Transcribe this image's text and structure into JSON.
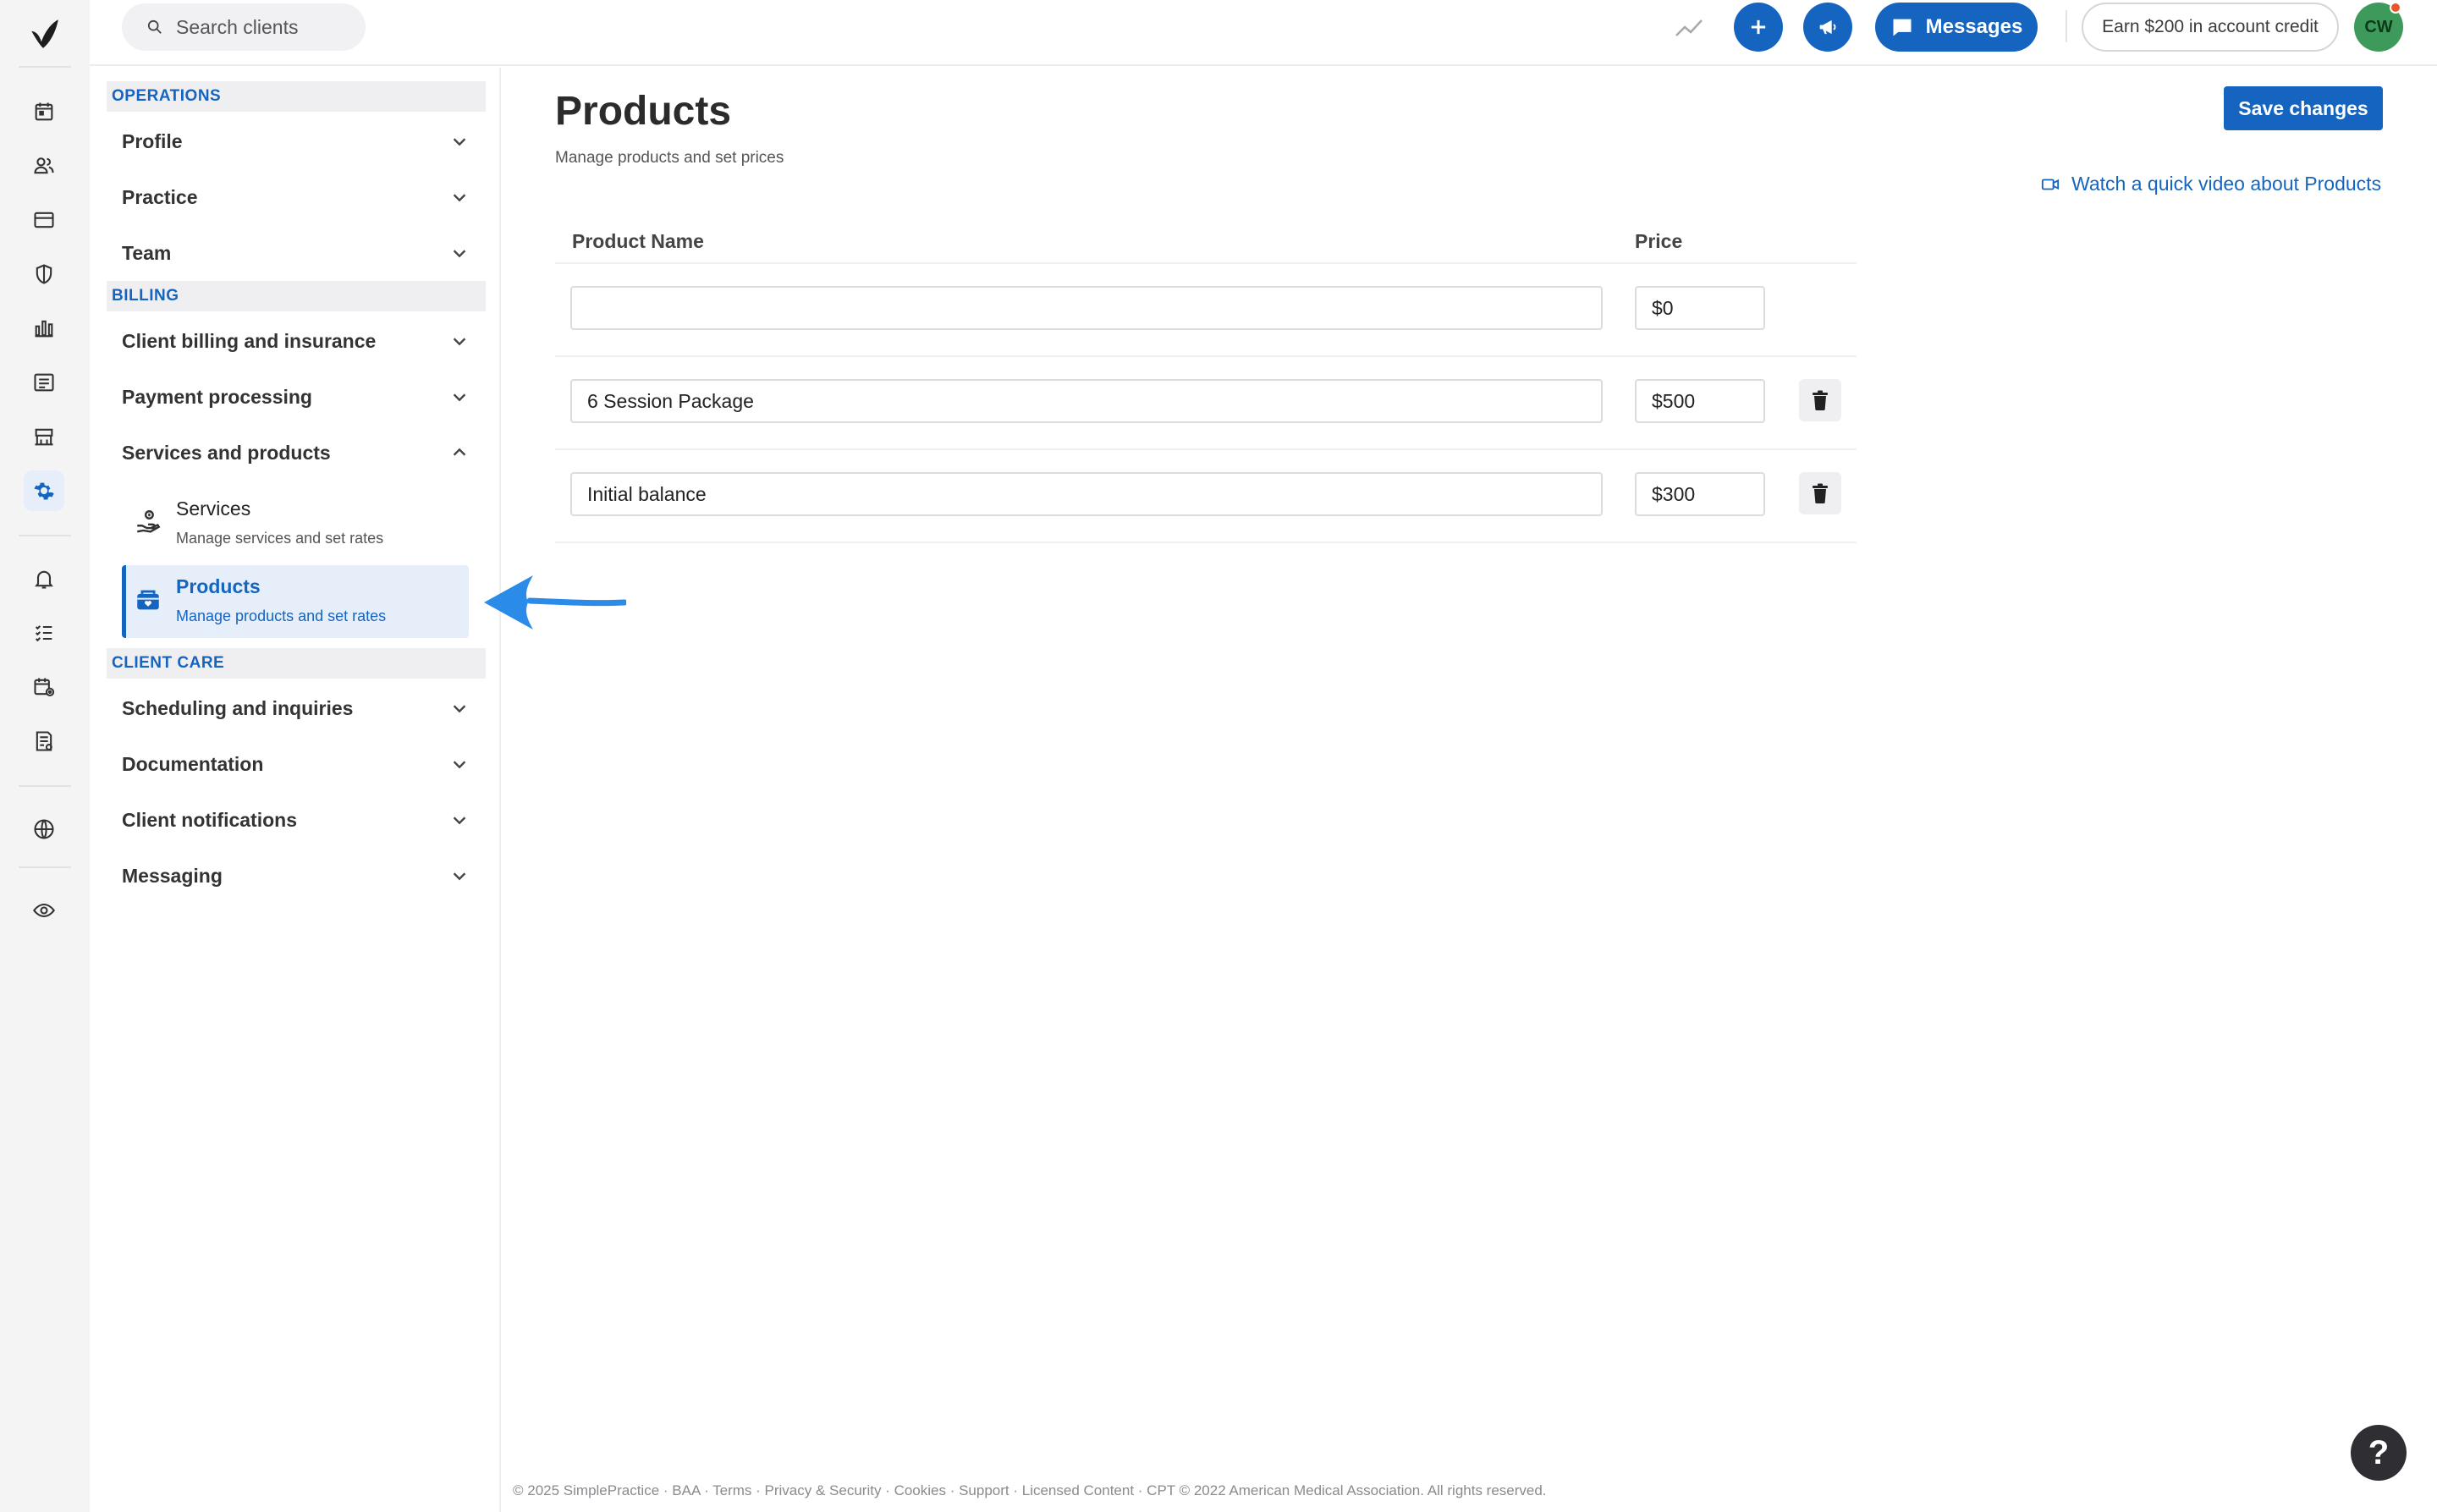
{
  "search": {
    "placeholder": "Search clients"
  },
  "topbar": {
    "messages_label": "Messages",
    "earn_label": "Earn $200 in account credit",
    "avatar_initials": "CW"
  },
  "rail": {
    "icons": [
      "logo-icon",
      "calendar-icon",
      "clients-icon",
      "billing-icon",
      "insurance-shield-icon",
      "analytics-icon",
      "documents-icon",
      "marketplace-icon",
      "settings-gear-icon",
      "notifications-bell-icon",
      "tasks-list-icon",
      "calendar-settings-icon",
      "reports-icon",
      "globe-icon",
      "eye-icon"
    ],
    "active": "settings-gear-icon"
  },
  "settings_nav": {
    "sections": [
      {
        "heading": "OPERATIONS",
        "items": [
          "Profile",
          "Practice",
          "Team"
        ]
      },
      {
        "heading": "BILLING",
        "items": [
          "Client billing and insurance",
          "Payment processing",
          "Services and products"
        ]
      },
      {
        "heading": "CLIENT CARE",
        "items": [
          "Scheduling and inquiries",
          "Documentation",
          "Client notifications",
          "Messaging"
        ]
      }
    ],
    "sub_items": [
      {
        "title": "Services",
        "desc": "Manage services and set rates"
      },
      {
        "title": "Products",
        "desc": "Manage products and set rates"
      }
    ],
    "active_sub_item": "Products"
  },
  "main": {
    "title": "Products",
    "subtitle": "Manage products and set prices",
    "save_label": "Save changes",
    "video_link": "Watch a quick video about Products",
    "columns": [
      "Product Name",
      "Price"
    ],
    "products": [
      {
        "name": "",
        "price": "$0"
      },
      {
        "name": "6 Session Package",
        "price": "$500"
      },
      {
        "name": "Initial balance",
        "price": "$300"
      }
    ]
  },
  "footer": {
    "text": "© 2025 SimplePractice · BAA · Terms · Privacy & Security · Cookies · Support · Licensed Content · CPT © 2022 American Medical Association. All rights reserved."
  },
  "help": {
    "label": "?"
  },
  "colors": {
    "brand": "#1565c0",
    "active_bg": "#e6eef9",
    "annotation_arrow": "#2b8be8",
    "avatar": "#3d9a5b"
  }
}
